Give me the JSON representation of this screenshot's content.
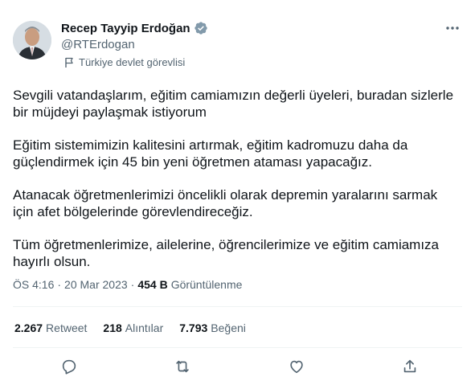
{
  "author": {
    "display_name": "Recep Tayyip Erdoğan",
    "handle": "@RTErdogan",
    "label": "Türkiye devlet görevlisi"
  },
  "body": {
    "paragraphs": [
      "Sevgili vatandaşlarım, eğitim camiamızın değerli üyeleri, buradan sizlerle\nbir müjdeyi paylaşmak istiyorum",
      "Eğitim sistemimizin kalitesini artırmak, eğitim kadromuzu daha da\ngüçlendirmek için 45 bin yeni öğretmen ataması yapacağız.",
      "Atanacak öğretmenlerimizi öncelikli olarak depremin yaralarını sarmak\niçin afet bölgelerinde görevlendireceğiz.",
      "Tüm öğretmenlerimize, ailelerine, öğrencilerimize ve eğitim camiamıza\nhayırlı olsun."
    ]
  },
  "meta": {
    "time": "ÖS 4:16",
    "separator1": "·",
    "date": "20 Mar 2023",
    "separator2": "·",
    "views_count": "454 B",
    "views_label": "Görüntülenme"
  },
  "stats": {
    "retweets": {
      "count": "2.267",
      "label": "Retweet"
    },
    "quotes": {
      "count": "218",
      "label": "Alıntılar"
    },
    "likes": {
      "count": "7.793",
      "label": "Beğeni"
    }
  },
  "icons": {
    "verified": "verified-badge-icon",
    "label": "flag-icon",
    "more": "more-icon",
    "reply": "reply-icon",
    "retweet": "retweet-icon",
    "like": "like-icon",
    "share": "share-icon"
  },
  "colors": {
    "text_primary": "#0f1419",
    "text_secondary": "#536471",
    "verified_badge": "#829aab",
    "divider": "#eff3f4"
  }
}
